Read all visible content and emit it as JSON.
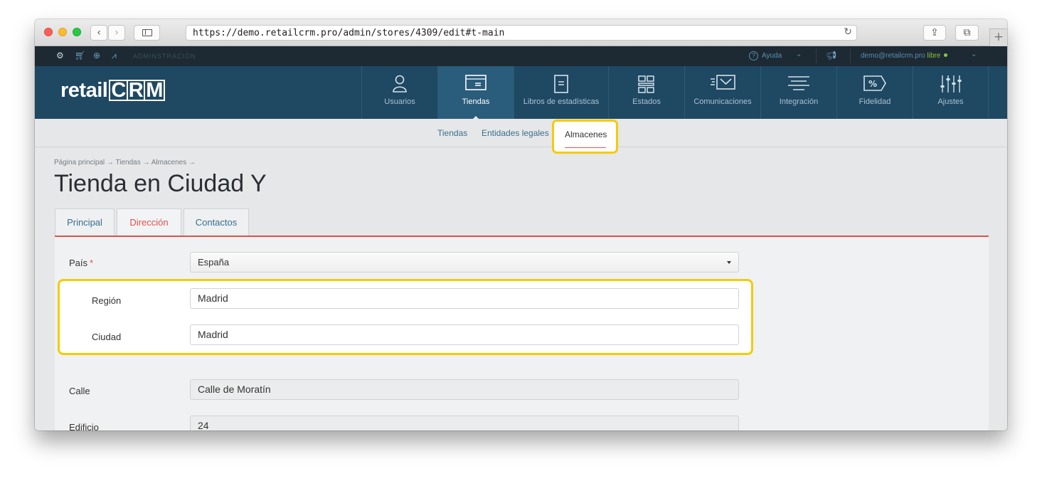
{
  "browser": {
    "url": "https://demo.retailcrm.pro/admin/stores/4309/edit#t-main",
    "back_icon": "‹",
    "forward_icon": "›",
    "reload_icon": "↻",
    "share_icon": "⇪",
    "tabs_icon": "⧉",
    "newtab_icon": "+"
  },
  "adminbar": {
    "section_label": "ADMINSTRACIÓN",
    "help_label": "Ayuda",
    "user_email": "demo@retailcrm.pro",
    "plan": "libre"
  },
  "logo": {
    "prefix": "retail",
    "letters": [
      "C",
      "R",
      "M"
    ]
  },
  "nav": {
    "items": [
      {
        "label": "Usuarios",
        "icon": "user-icon"
      },
      {
        "label": "Tiendas",
        "icon": "store-icon"
      },
      {
        "label": "Libros de estadísticas",
        "icon": "book-icon"
      },
      {
        "label": "Estados",
        "icon": "states-icon"
      },
      {
        "label": "Comunicaciones",
        "icon": "mail-icon"
      },
      {
        "label": "Integración",
        "icon": "integration-icon"
      },
      {
        "label": "Fidelidad",
        "icon": "percent-tag-icon"
      },
      {
        "label": "Ajustes",
        "icon": "sliders-icon"
      }
    ],
    "active": "Tiendas"
  },
  "subnav": {
    "items": [
      "Tiendas",
      "Entidades legales",
      "Almacenes"
    ],
    "active": "Almacenes"
  },
  "breadcrumb": "Página principal → Tiendas → Almacenes →",
  "page_title": "Tienda en Ciudad Y",
  "tabs": {
    "items": [
      "Principal",
      "Dirección",
      "Contactos"
    ],
    "active": "Dirección"
  },
  "form": {
    "pais": {
      "label": "País",
      "required_mark": "*",
      "value": "España"
    },
    "region": {
      "label": "Región",
      "value": "Madrid"
    },
    "ciudad": {
      "label": "Ciudad",
      "value": "Madrid"
    },
    "calle": {
      "label": "Calle",
      "value": "Calle de Moratín"
    },
    "edificio": {
      "label": "Edificio",
      "value": "24"
    }
  },
  "colors": {
    "navbar": "#1f4862",
    "adminbar": "#1d2a33",
    "accent_red": "#d9534f",
    "highlight_yellow": "#f2cc0c",
    "link_blue": "#3a6d8f"
  }
}
